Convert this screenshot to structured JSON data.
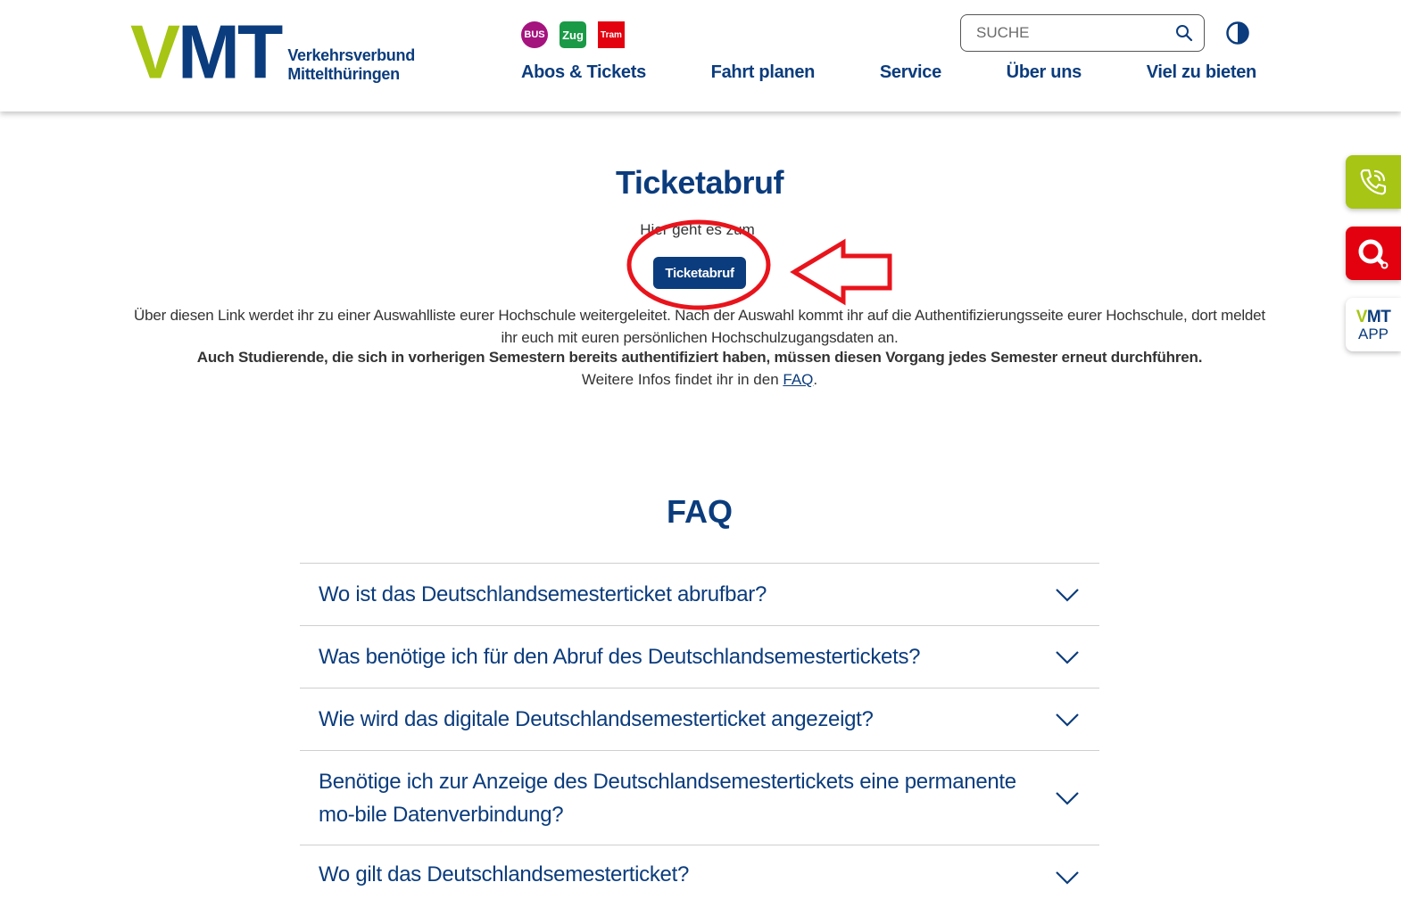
{
  "header": {
    "logo": {
      "mark_v": "V",
      "mark_mt": "MT",
      "line1": "Verkehrsverbund",
      "line2": "Mittelthüringen"
    },
    "modes": [
      {
        "label": "BUS",
        "color": "#a5137e"
      },
      {
        "label": "Zug",
        "color": "#1a9a46"
      },
      {
        "label": "Tram",
        "color": "#e3000f"
      }
    ],
    "search": {
      "placeholder": "SUCHE",
      "value": ""
    },
    "contrast_icon": "contrast-icon",
    "nav": [
      "Abos & Tickets",
      "Fahrt planen",
      "Service",
      "Über uns",
      "Viel zu bieten"
    ]
  },
  "side_buttons": {
    "phone_icon": "phone-icon",
    "chat_icon": "chat-search-icon",
    "app_vmt_v": "V",
    "app_vmt_mt": "MT",
    "app_label": "APP"
  },
  "main": {
    "title": "Ticketabruf",
    "intro": "Hier geht es zum",
    "button": "Ticketabruf",
    "text_part1": "Über diesen Link werdet ihr zu einer Auswahlliste eurer Hochschule weitergeleitet. Nach der Auswahl kommt ihr auf die Authentifizierungsseite eurer Hochschule, dort meldet ihr euch mit euren persönlichen Hochschulzugangsdaten an.",
    "text_bold": "Auch Studierende, die sich in vorherigen Semestern bereits authentifiziert haben, müssen diesen Vorgang jedes Semester erneut durchführen.",
    "more_prefix": "Weitere Infos findet ihr in den ",
    "more_link": "FAQ",
    "more_suffix": "."
  },
  "faq": {
    "title": "FAQ",
    "items": [
      "Wo ist das Deutschlandsemesterticket abrufbar?",
      "Was benötige ich für den Abruf des Deutschlandsemestertickets?",
      "Wie wird das digitale Deutschlandsemesterticket angezeigt?",
      "Benötige ich zur Anzeige des Deutschlandsemestertickets eine permanente mo-bile Datenverbindung?",
      "Wo gilt das Deutschlandsemesterticket?"
    ]
  },
  "colors": {
    "brand_blue": "#0b3c7d",
    "brand_green": "#a6c514",
    "brand_red": "#e3000f",
    "annotation_red": "#e8141c"
  }
}
